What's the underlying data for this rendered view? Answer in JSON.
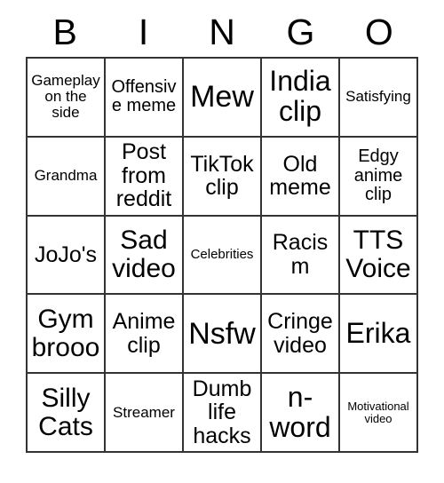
{
  "card": {
    "header_letters": [
      "B",
      "I",
      "N",
      "G",
      "O"
    ],
    "rows": [
      [
        {
          "label": "Gameplay on the side",
          "size": "xs"
        },
        {
          "label": "Offensive meme",
          "size": "sm"
        },
        {
          "label": "Mew",
          "size": "xxl"
        },
        {
          "label": "India clip",
          "size": "xl"
        },
        {
          "label": "Satisfying",
          "size": "xs"
        }
      ],
      [
        {
          "label": "Grandma",
          "size": "xs"
        },
        {
          "label": "Post from reddit",
          "size": "md"
        },
        {
          "label": "TikTok clip",
          "size": "md"
        },
        {
          "label": "Old meme",
          "size": "md"
        },
        {
          "label": "Edgy anime clip",
          "size": "sm"
        }
      ],
      [
        {
          "label": "JoJo's",
          "size": "md"
        },
        {
          "label": "Sad video",
          "size": "lg"
        },
        {
          "label": "Celebrities",
          "size": "xxs"
        },
        {
          "label": "Racism",
          "size": "md"
        },
        {
          "label": "TTS Voice",
          "size": "lg"
        }
      ],
      [
        {
          "label": "Gym brooo",
          "size": "lg"
        },
        {
          "label": "Anime clip",
          "size": "md"
        },
        {
          "label": "Nsfw",
          "size": "xxl"
        },
        {
          "label": "Cringe video",
          "size": "md"
        },
        {
          "label": "Erika",
          "size": "xl"
        }
      ],
      [
        {
          "label": "Silly Cats",
          "size": "lg"
        },
        {
          "label": "Streamer",
          "size": "xs"
        },
        {
          "label": "Dumb life hacks",
          "size": "md"
        },
        {
          "label": "n-word",
          "size": "xl"
        },
        {
          "label": "Motivational video",
          "size": "tiny"
        }
      ]
    ]
  },
  "colors": {
    "background": "#ffffff",
    "text": "#000000",
    "grid_line": "#333333"
  }
}
